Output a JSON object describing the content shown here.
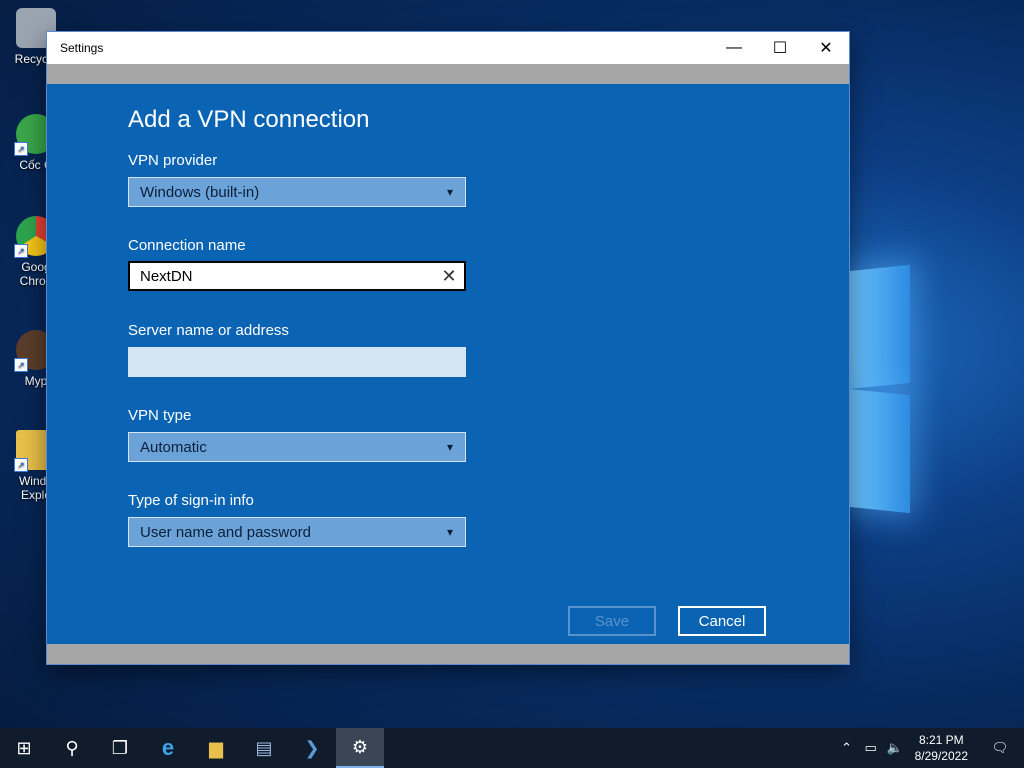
{
  "desktop": {
    "icons": [
      {
        "label": "Recycle",
        "color": "#9aa5b1"
      },
      {
        "label": "Cốc C",
        "color": "#3aa64a"
      },
      {
        "label": "Goog Chron",
        "color": "#e34133"
      },
      {
        "label": "Myp",
        "color": "#5a3d2b"
      },
      {
        "label": "Windo Explo",
        "color": "#e8c04a"
      }
    ]
  },
  "window": {
    "title": "Settings",
    "minimize": "—",
    "maximize": "☐",
    "close": "✕"
  },
  "form": {
    "heading": "Add a VPN connection",
    "provider_label": "VPN provider",
    "provider_value": "Windows (built-in)",
    "connection_label": "Connection name",
    "connection_value": "NextDN",
    "server_label": "Server name or address",
    "server_value": "",
    "type_label": "VPN type",
    "type_value": "Automatic",
    "signin_label": "Type of sign-in info",
    "signin_value": "User name and password",
    "save": "Save",
    "cancel": "Cancel"
  },
  "taskbar": {
    "time": "8:21 PM",
    "date": "8/29/2022"
  },
  "colors": {
    "accent": "#0a64b3",
    "dropdown_bg": "#6ba2d8"
  }
}
